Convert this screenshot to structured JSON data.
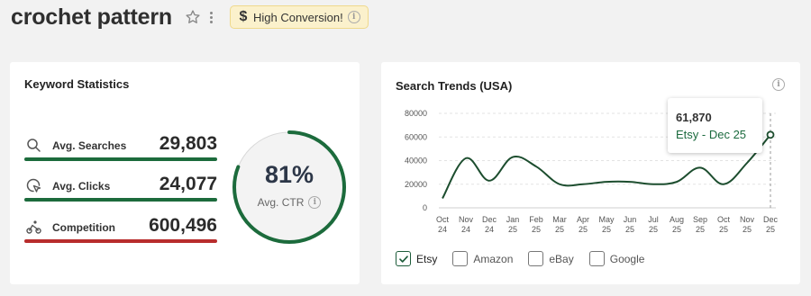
{
  "header": {
    "title": "crochet pattern",
    "badge_label": "High Conversion!",
    "badge_icon": "dollar-icon"
  },
  "keyword_stats": {
    "title": "Keyword Statistics",
    "items": [
      {
        "label": "Avg. Searches",
        "value": "29,803",
        "icon": "search-icon",
        "bar_color": "#1c6b3c"
      },
      {
        "label": "Avg. Clicks",
        "value": "24,077",
        "icon": "click-icon",
        "bar_color": "#1c6b3c"
      },
      {
        "label": "Competition",
        "value": "600,496",
        "icon": "competition-icon",
        "bar_color": "#b82c2c"
      }
    ],
    "ctr": {
      "value": "81%",
      "label": "Avg. CTR",
      "percent": 81,
      "ring_color": "#1c6b3c"
    }
  },
  "trends": {
    "title": "Search Trends (USA)",
    "tooltip": {
      "value": "61,870",
      "series_point": "Etsy - Dec 25"
    },
    "legend": [
      {
        "label": "Etsy",
        "checked": true
      },
      {
        "label": "Amazon",
        "checked": false
      },
      {
        "label": "eBay",
        "checked": false
      },
      {
        "label": "Google",
        "checked": false
      }
    ]
  },
  "colors": {
    "accent": "#1c6b3c",
    "danger": "#b82c2c",
    "badge_bg": "#fbf1cc"
  },
  "chart_data": {
    "type": "line",
    "title": "Search Trends (USA)",
    "categories": [
      [
        "Oct",
        "24"
      ],
      [
        "Nov",
        "24"
      ],
      [
        "Dec",
        "24"
      ],
      [
        "Jan",
        "25"
      ],
      [
        "Feb",
        "25"
      ],
      [
        "Mar",
        "25"
      ],
      [
        "Apr",
        "25"
      ],
      [
        "May",
        "25"
      ],
      [
        "Jun",
        "25"
      ],
      [
        "Jul",
        "25"
      ],
      [
        "Aug",
        "25"
      ],
      [
        "Sep",
        "25"
      ],
      [
        "Oct",
        "25"
      ],
      [
        "Nov",
        "25"
      ],
      [
        "Dec",
        "25"
      ]
    ],
    "series": [
      {
        "name": "Etsy",
        "color": "#1c4d2e",
        "values": [
          8000,
          42000,
          23000,
          43000,
          35000,
          20000,
          20000,
          22000,
          22000,
          20000,
          22000,
          34000,
          20000,
          38000,
          61870
        ]
      }
    ],
    "ylim": [
      0,
      80000
    ],
    "yticks": [
      0,
      20000,
      40000,
      60000,
      80000
    ],
    "grid": true,
    "legend_position": "bottom-left"
  }
}
